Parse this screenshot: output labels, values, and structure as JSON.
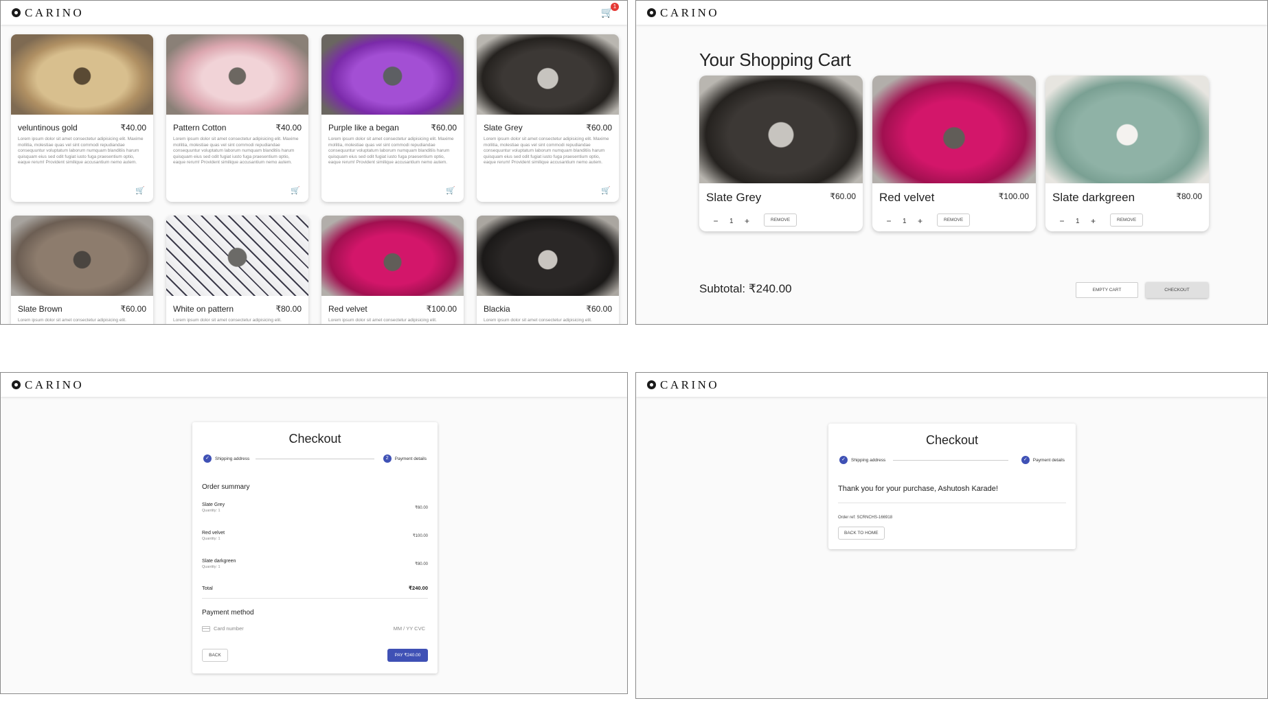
{
  "brand": {
    "name": "CARINO"
  },
  "header": {
    "cart_count": "1"
  },
  "products": [
    {
      "name": "veluntinous gold",
      "price": "₹40.00",
      "image": "gold"
    },
    {
      "name": "Pattern Cotton",
      "price": "₹40.00",
      "image": "pink"
    },
    {
      "name": "Purple like a began",
      "price": "₹60.00",
      "image": "purple"
    },
    {
      "name": "Slate Grey",
      "price": "₹60.00",
      "image": "slategrey"
    },
    {
      "name": "Slate Brown",
      "price": "₹60.00",
      "image": "brown"
    },
    {
      "name": "White on pattern",
      "price": "₹80.00",
      "image": "white"
    },
    {
      "name": "Red velvet",
      "price": "₹100.00",
      "image": "red"
    },
    {
      "name": "Blackia",
      "price": "₹60.00",
      "image": "black"
    }
  ],
  "product_description": "Lorem ipsum dolor sit amet consectetur adipisicing elit. Maxime mollitia, molestiae quas vel sint commodi repudiandae consequuntur voluptatum laborum numquam blanditiis harum quisquam eius sed odit fugiat iusto fuga praesentium optio, eaque rerum! Provident similique accusantium nemo autem.",
  "product_description_short": "Lorem ipsum dolor sit amet consectetur adipisicing elit.",
  "cart": {
    "title": "Your Shopping Cart",
    "items": [
      {
        "name": "Slate Grey",
        "price": "₹60.00",
        "qty": "1",
        "image": "slategrey"
      },
      {
        "name": "Red velvet",
        "price": "₹100.00",
        "qty": "1",
        "image": "red"
      },
      {
        "name": "Slate darkgreen",
        "price": "₹80.00",
        "qty": "1",
        "image": "darkgreen"
      }
    ],
    "remove_label": "REMOVE",
    "subtotal": "Subtotal: ₹240.00",
    "empty_label": "EMPTY CART",
    "checkout_label": "CHECKOUT"
  },
  "checkout": {
    "title": "Checkout",
    "steps": [
      "Shipping address",
      "Payment details"
    ],
    "step2_number": "2",
    "summary_title": "Order summary",
    "items": [
      {
        "name": "Slate Grey",
        "qty": "Quantity: 1",
        "price": "₹60.00"
      },
      {
        "name": "Red velvet",
        "qty": "Quantity: 1",
        "price": "₹100.00"
      },
      {
        "name": "Slate darkgreen",
        "qty": "Quantity: 1",
        "price": "₹80.00"
      }
    ],
    "total_label": "Total",
    "total_value": "₹240.00",
    "payment_title": "Payment method",
    "card_placeholder": "Card number",
    "expiry_cvc": "MM / YY  CVC",
    "back_label": "BACK",
    "pay_label": "PAY ₹240.00"
  },
  "confirmation": {
    "title": "Checkout",
    "thanks": "Thank you for your purchase, Ashutosh Karade!",
    "order_ref": "Order ref: SCRNCHS-166918",
    "home_label": "BACK TO HOME"
  }
}
